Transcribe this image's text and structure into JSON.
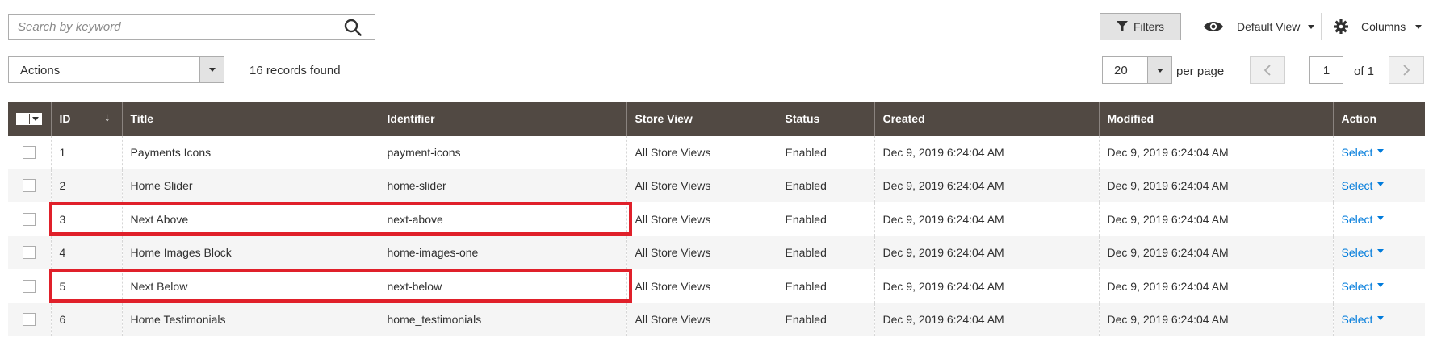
{
  "search": {
    "placeholder": "Search by keyword",
    "value": ""
  },
  "toolbar": {
    "filters_label": "Filters",
    "view_label": "Default View",
    "columns_label": "Columns"
  },
  "actions": {
    "label": "Actions"
  },
  "records_found": "16 records found",
  "pagination": {
    "per_page_value": "20",
    "per_page_label": "per page",
    "current_page": "1",
    "of_label": "of 1"
  },
  "table": {
    "headers": [
      "ID",
      "Title",
      "Identifier",
      "Store View",
      "Status",
      "Created",
      "Modified",
      "Action"
    ],
    "rows": [
      {
        "id": "1",
        "title": "Payments Icons",
        "identifier": "payment-icons",
        "store_view": "All Store Views",
        "status": "Enabled",
        "created": "Dec 9, 2019 6:24:04 AM",
        "modified": "Dec 9, 2019 6:24:04 AM",
        "action": "Select"
      },
      {
        "id": "2",
        "title": "Home Slider",
        "identifier": "home-slider",
        "store_view": "All Store Views",
        "status": "Enabled",
        "created": "Dec 9, 2019 6:24:04 AM",
        "modified": "Dec 9, 2019 6:24:04 AM",
        "action": "Select"
      },
      {
        "id": "3",
        "title": "Next Above",
        "identifier": "next-above",
        "store_view": "All Store Views",
        "status": "Enabled",
        "created": "Dec 9, 2019 6:24:04 AM",
        "modified": "Dec 9, 2019 6:24:04 AM",
        "action": "Select"
      },
      {
        "id": "4",
        "title": "Home Images Block",
        "identifier": "home-images-one",
        "store_view": "All Store Views",
        "status": "Enabled",
        "created": "Dec 9, 2019 6:24:04 AM",
        "modified": "Dec 9, 2019 6:24:04 AM",
        "action": "Select"
      },
      {
        "id": "5",
        "title": "Next Below",
        "identifier": "next-below",
        "store_view": "All Store Views",
        "status": "Enabled",
        "created": "Dec 9, 2019 6:24:04 AM",
        "modified": "Dec 9, 2019 6:24:04 AM",
        "action": "Select"
      },
      {
        "id": "6",
        "title": "Home Testimonials",
        "identifier": "home_testimonials",
        "store_view": "All Store Views",
        "status": "Enabled",
        "created": "Dec 9, 2019 6:24:04 AM",
        "modified": "Dec 9, 2019 6:24:04 AM",
        "action": "Select"
      }
    ]
  },
  "colors": {
    "header_bg": "#514943",
    "link": "#007bdb",
    "highlight": "#e0202a"
  },
  "icons": [
    "search-icon",
    "filter-icon",
    "eye-icon",
    "gear-icon",
    "chevron-down-icon",
    "chevron-left-icon",
    "chevron-right-icon",
    "sort-down-arrow-icon"
  ]
}
